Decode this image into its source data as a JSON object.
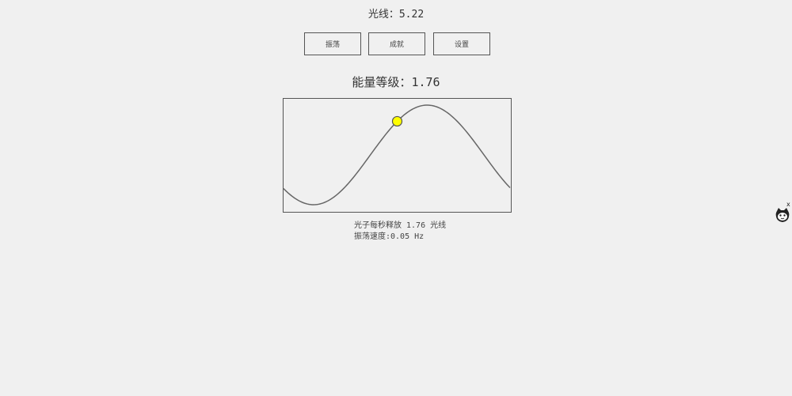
{
  "header": {
    "light_label": "光线：",
    "light_value": "5.22"
  },
  "buttons": {
    "oscillate": "振荡",
    "achievements": "成就",
    "settings": "设置"
  },
  "energy": {
    "label": "能量等级：",
    "value": "1.76"
  },
  "wave": {
    "phase_fraction": 0.5,
    "line_color": "#666666",
    "marker_color": "#ffff00"
  },
  "stats": {
    "photon_line": "光子每秒释放 1.76 光线",
    "speed_line": "振荡速度:0.05 Hz"
  },
  "mascot": {
    "icon": "cat-face-icon",
    "close_label": "x"
  }
}
